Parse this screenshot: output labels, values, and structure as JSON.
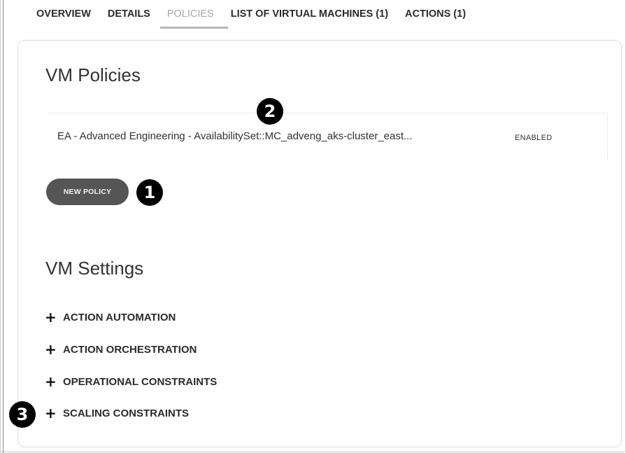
{
  "tabs": [
    {
      "label": "OVERVIEW"
    },
    {
      "label": "DETAILS"
    },
    {
      "label": "POLICIES"
    },
    {
      "label": "LIST OF VIRTUAL MACHINES (1)"
    },
    {
      "label": "ACTIONS (1)"
    }
  ],
  "active_tab": "POLICIES",
  "policies_section": {
    "title": "VM Policies",
    "rows": [
      {
        "name": "EA - Advanced Engineering - AvailabilitySet::MC_adveng_aks-cluster_east...",
        "status": "ENABLED"
      }
    ],
    "new_policy_label": "NEW POLICY"
  },
  "settings_section": {
    "title": "VM Settings",
    "items": [
      {
        "label": "ACTION AUTOMATION"
      },
      {
        "label": "ACTION ORCHESTRATION"
      },
      {
        "label": "OPERATIONAL CONSTRAINTS"
      },
      {
        "label": "SCALING CONSTRAINTS"
      }
    ]
  },
  "callouts": [
    "1",
    "2",
    "3"
  ],
  "icons": {
    "expand": "plus-icon"
  },
  "colors": {
    "button_bg": "#555555",
    "active_tab_text": "#a8a8a8",
    "callout_bg": "#000000"
  }
}
